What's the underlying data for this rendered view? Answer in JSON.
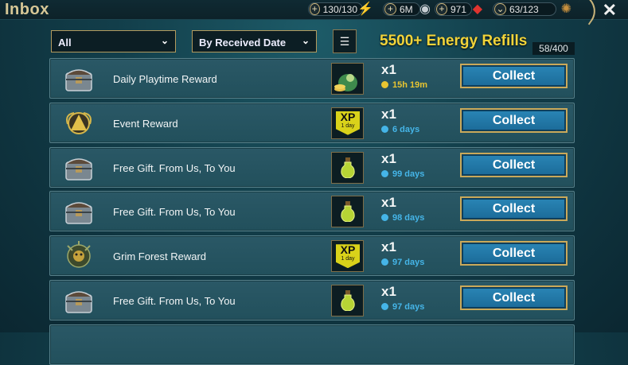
{
  "header": {
    "title": "Inbox",
    "resources": [
      {
        "value": "130/130",
        "icon": "energy-bolt-icon"
      },
      {
        "value": "6M",
        "icon": "silver-coin-icon"
      },
      {
        "value": "971",
        "icon": "ruby-gem-icon"
      },
      {
        "value": "63/123",
        "icon": "shield-wheel-icon"
      }
    ],
    "close_label": "✕"
  },
  "filters": {
    "type_selected": "All",
    "sort_selected": "By Received Date",
    "sort_icon": "sort-icon"
  },
  "promo": "5500+ Energy Refills",
  "count": "58/400",
  "rows": [
    {
      "label": "Daily Playtime Reward",
      "qty": "x1",
      "timer": "15h 19m",
      "timer_color": "#e8c531",
      "icon": "chest-icon",
      "reward": "money-bag-icon",
      "collect": "Collect"
    },
    {
      "label": "Event Reward",
      "qty": "x1",
      "timer": "6 days",
      "timer_color": "#45b5e8",
      "icon": "event-emblem-icon",
      "reward": "xp-boost-icon",
      "reward_text": "XP",
      "reward_sub": "1 day",
      "collect": "Collect"
    },
    {
      "label": "Free Gift. From Us, To You",
      "qty": "x1",
      "timer": "99 days",
      "timer_color": "#45b5e8",
      "icon": "chest-icon",
      "reward": "energy-potion-icon",
      "collect": "Collect"
    },
    {
      "label": "Free Gift. From Us, To You",
      "qty": "x1",
      "timer": "98 days",
      "timer_color": "#45b5e8",
      "icon": "chest-icon",
      "reward": "energy-potion-icon",
      "collect": "Collect"
    },
    {
      "label": "Grim Forest Reward",
      "qty": "x1",
      "timer": "97 days",
      "timer_color": "#45b5e8",
      "icon": "grim-forest-icon",
      "reward": "xp-boost-icon",
      "reward_text": "XP",
      "reward_sub": "1 day",
      "collect": "Collect"
    },
    {
      "label": "Free Gift. From Us, To You",
      "qty": "x1",
      "timer": "97 days",
      "timer_color": "#45b5e8",
      "icon": "chest-icon",
      "reward": "energy-potion-icon",
      "collect": "Collect"
    }
  ],
  "colors": {
    "accent": "#f2d43a",
    "button": "#2a86b6",
    "border_gold": "#caa95a"
  }
}
